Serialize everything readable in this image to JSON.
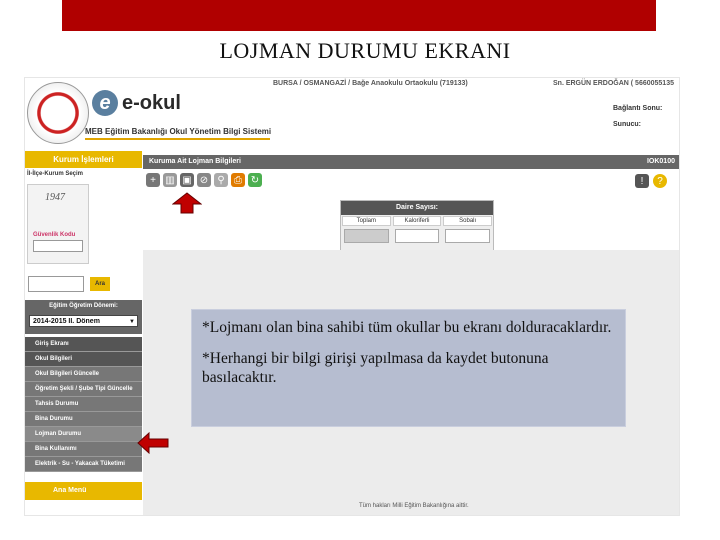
{
  "slide": {
    "title": "LOJMAN DURUMU EKRANI"
  },
  "header": {
    "logo_text": "e-okul",
    "logo_sub": "MEB Eğitim Bakanlığı Okul Yönetim Bilgi Sistemi",
    "breadcrumb": "BURSA / OSMANGAZİ / Bağe Anaokulu Ortaokulu (719133)",
    "user": "Sn. ERGÜN ERDOĞAN ( 5660055135",
    "connection_label": "Bağlantı Sonu:",
    "server_label": "Sunucu:"
  },
  "sidebar": {
    "section_title": "Kurum İşlemleri",
    "sub_title": "İl-İlçe-Kurum Seçim",
    "captcha_text": "1947",
    "captcha_label": "Güvenlik Kodu",
    "search_button": "Ara",
    "term_label": "Eğitim Öğretim Dönemi:",
    "term_value": "2014-2015 II. Dönem",
    "menu": [
      {
        "label": "Giriş Ekranı",
        "kind": "sec"
      },
      {
        "label": "Okul Bilgileri",
        "kind": "sec"
      },
      {
        "label": "Okul Bilgileri Güncelle",
        "kind": "item"
      },
      {
        "label": "Öğretim Şekli / Şube Tipi Güncelle",
        "kind": "item"
      },
      {
        "label": "Tahsis Durumu",
        "kind": "item"
      },
      {
        "label": "Bina Durumu",
        "kind": "item"
      },
      {
        "label": "Lojman Durumu",
        "kind": "hi"
      },
      {
        "label": "Bina Kullanımı",
        "kind": "item"
      },
      {
        "label": "Elektrik - Su - Yakacak Tüketimi",
        "kind": "item"
      }
    ],
    "main_menu": "Ana Menü"
  },
  "main": {
    "title": "Kuruma Ait Lojman Bilgileri",
    "code": "IOK0100",
    "daire": {
      "title": "Daire Sayısı:",
      "columns": [
        "Toplam",
        "Kaloriferli",
        "Sobalı"
      ]
    },
    "footer": "Tüm hakları Milli Eğitim Bakanlığına aittir."
  },
  "note": {
    "line1": "*Lojmanı olan bina sahibi tüm okullar bu ekranı dolduracaklardır.",
    "line2": "*Herhangi bir bilgi girişi yapılmasa da kaydet butonuna basılacaktır."
  },
  "colors": {
    "accent": "#b00000",
    "yellow": "#e8b800",
    "note_bg": "#b6bdd0"
  }
}
